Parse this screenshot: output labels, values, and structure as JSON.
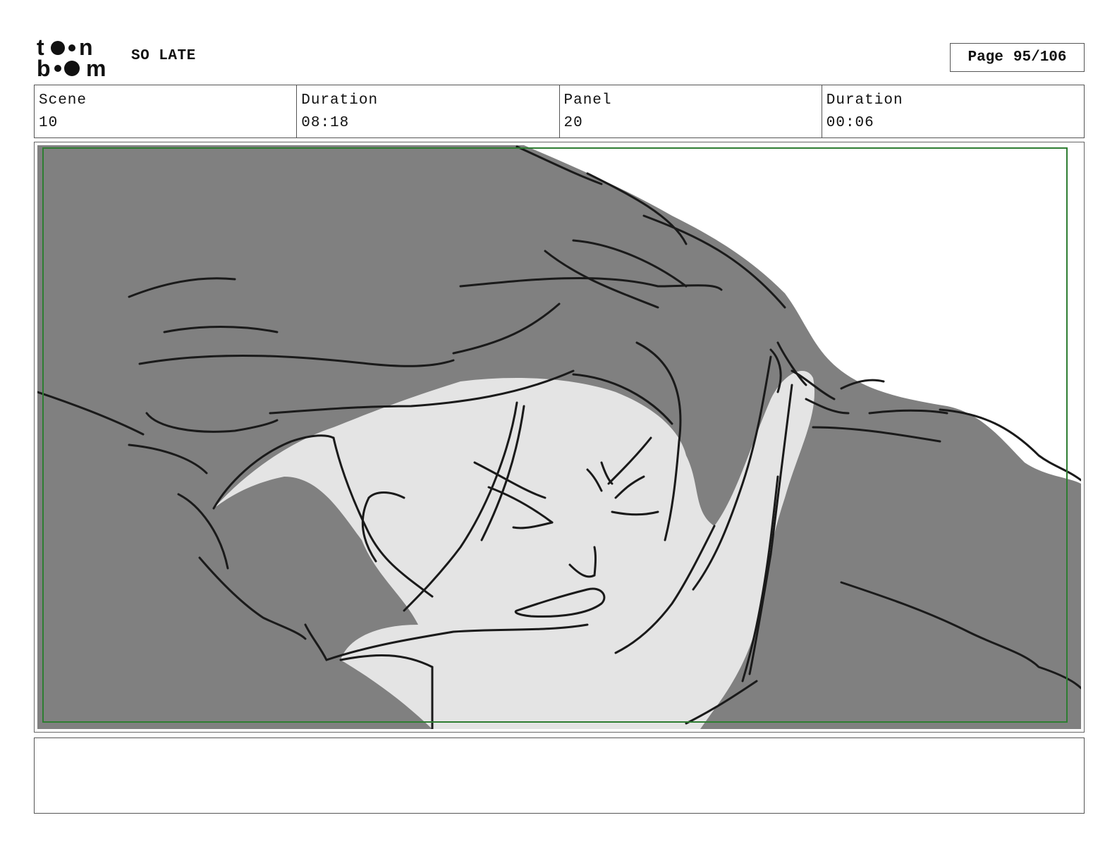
{
  "header": {
    "logo_text": "toon boom",
    "project_title": "SO LATE",
    "page_label": "Page",
    "page_value": "95/106"
  },
  "info": {
    "scene_label": "Scene",
    "scene_value": "10",
    "scene_duration_label": "Duration",
    "scene_duration_value": "08:18",
    "panel_label": "Panel",
    "panel_value": "20",
    "panel_duration_label": "Duration",
    "panel_duration_value": "00:06"
  },
  "notes": {
    "text": ""
  },
  "colors": {
    "hair_fill": "#808080",
    "skin_fill": "#e4e4e4",
    "ink": "#1a1a1a",
    "safe_frame": "#2e7d32",
    "border": "#555555"
  }
}
